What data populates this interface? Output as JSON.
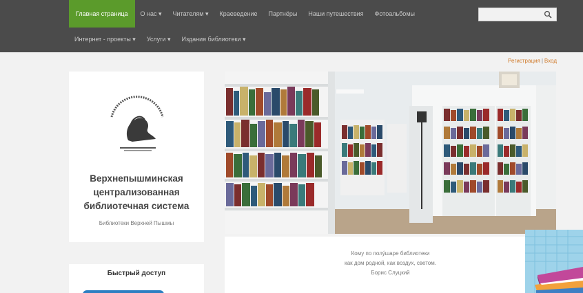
{
  "nav": {
    "primary": [
      {
        "label": "Главная страница",
        "active": true
      },
      {
        "label": "О нас ▾"
      },
      {
        "label": "Читателям ▾"
      },
      {
        "label": "Краеведение"
      },
      {
        "label": "Партнёры"
      },
      {
        "label": "Наши путешествия"
      },
      {
        "label": "Фотоальбомы"
      }
    ],
    "secondary": [
      {
        "label": "Интернет - проекты ▾"
      },
      {
        "label": "Услуги ▾"
      },
      {
        "label": "Издания библиотеки ▾"
      }
    ]
  },
  "search": {
    "placeholder": ""
  },
  "auth": {
    "register": "Регистрация",
    "separator": "|",
    "login": "Вход"
  },
  "org": {
    "title": "Верхнепышминская централизованная библиотечная система",
    "subtitle": "Библиотеки Верхней Пышмы"
  },
  "quick_access": {
    "title": "Быстрый доступ"
  },
  "quote": {
    "lines": [
      "Кому по полу́шаре библиотеки",
      "как дом родной, как воздух, светом.",
      "Борис Слуцкий"
    ]
  },
  "colors": {
    "topbar": "#4b4b4b",
    "active_nav": "#5b9b2b",
    "auth_links": "#d07a2a",
    "button": "#2d7fc2"
  }
}
